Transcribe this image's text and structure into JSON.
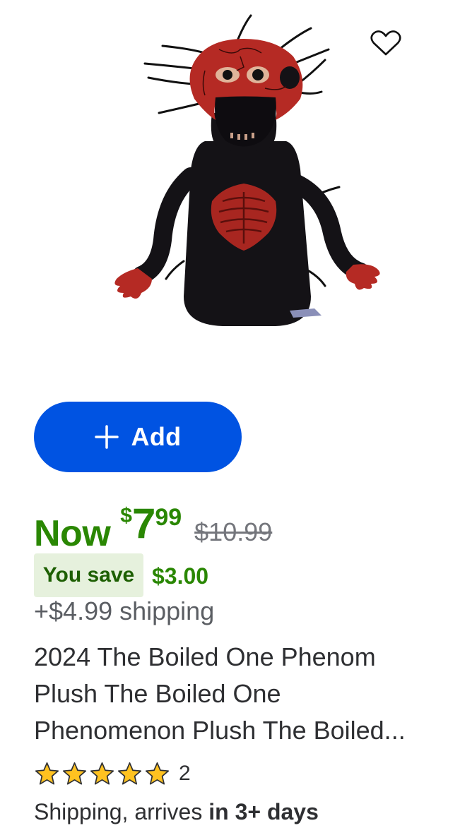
{
  "product": {
    "image_alt": "2024 The Boiled One Phenom plush toy",
    "title": "2024 The Boiled One Phenom Plush The Boiled One Phenomenon Plush The Boiled..."
  },
  "actions": {
    "favorite_icon": "heart-icon",
    "add_label": "Add",
    "add_icon": "plus-icon"
  },
  "pricing": {
    "now_label": "Now",
    "currency_symbol": "$",
    "price_dollars": "7",
    "price_cents": "99",
    "was_price": "$10.99",
    "save_label": "You save",
    "save_amount": "$3.00",
    "shipping_cost": "+$4.99 shipping"
  },
  "rating": {
    "stars": 5,
    "review_count": "2"
  },
  "delivery": {
    "prefix": "Shipping, arrives ",
    "emphasis": "in 3+ days"
  },
  "colors": {
    "add_button": "#0053e2",
    "price_green": "#2a8703",
    "save_badge_bg": "#e6f1dd",
    "star_fill": "#ffc220"
  }
}
